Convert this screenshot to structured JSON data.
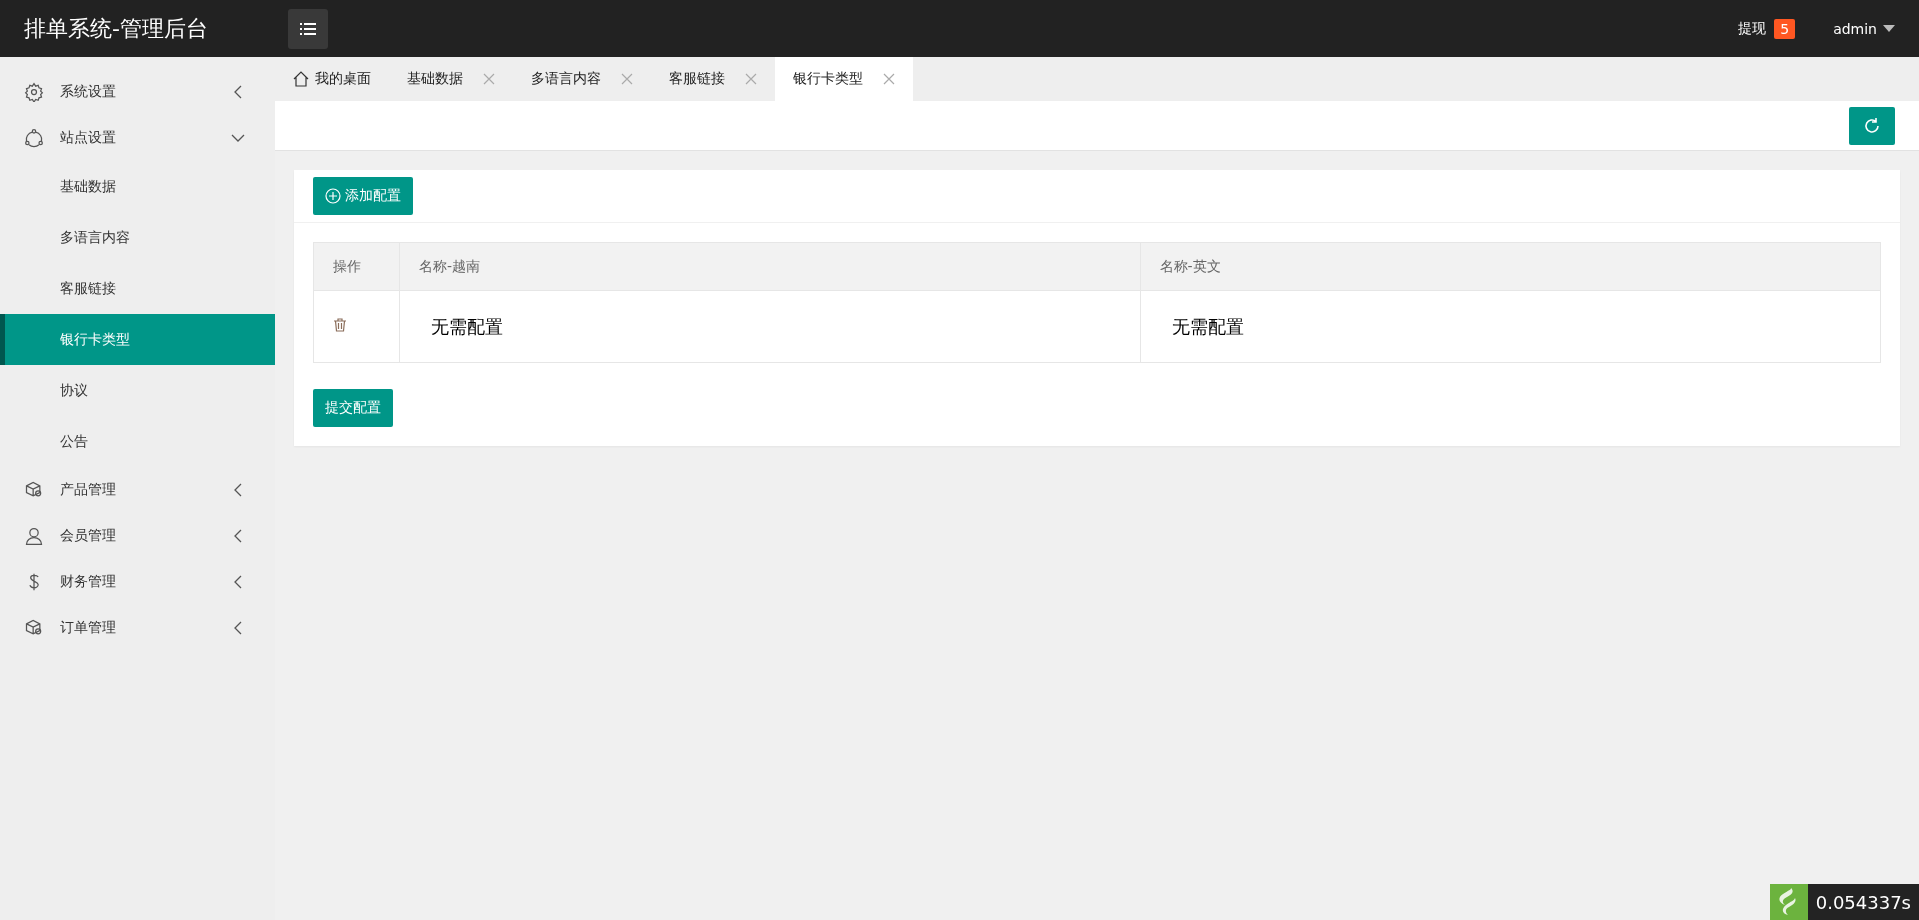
{
  "header": {
    "title": "排单系统-管理后台",
    "withdraw": {
      "label": "提现",
      "count": "5"
    },
    "user": "admin"
  },
  "sidebar": {
    "items": [
      {
        "label": "系统设置",
        "kind": "gear",
        "expanded": false,
        "selected": false
      },
      {
        "label": "站点设置",
        "kind": "network",
        "expanded": true,
        "selected": false,
        "children": [
          {
            "label": "基础数据",
            "selected": false
          },
          {
            "label": "多语言内容",
            "selected": false
          },
          {
            "label": "客服链接",
            "selected": false
          },
          {
            "label": "银行卡类型",
            "selected": true
          },
          {
            "label": "协议",
            "selected": false
          },
          {
            "label": "公告",
            "selected": false
          }
        ]
      },
      {
        "label": "产品管理",
        "kind": "box",
        "expanded": false,
        "selected": false
      },
      {
        "label": "会员管理",
        "kind": "user",
        "expanded": false,
        "selected": false
      },
      {
        "label": "财务管理",
        "kind": "dollar",
        "expanded": false,
        "selected": false
      },
      {
        "label": "订单管理",
        "kind": "box",
        "expanded": false,
        "selected": false
      }
    ]
  },
  "tabs": [
    {
      "label": "我的桌面",
      "kind": "home",
      "selected": false
    },
    {
      "label": "基础数据",
      "kind": "page",
      "selected": false
    },
    {
      "label": "多语言内容",
      "kind": "page",
      "selected": false
    },
    {
      "label": "客服链接",
      "kind": "page",
      "selected": false
    },
    {
      "label": "银行卡类型",
      "kind": "page",
      "selected": true
    }
  ],
  "card": {
    "add_button": "添加配置",
    "submit_button": "提交配置",
    "table": {
      "columns": [
        "操作",
        "名称-越南",
        "名称-英文"
      ],
      "rows": [
        {
          "values": [
            "无需配置",
            "无需配置"
          ]
        }
      ]
    }
  },
  "trace": {
    "time": "0.054337s"
  }
}
